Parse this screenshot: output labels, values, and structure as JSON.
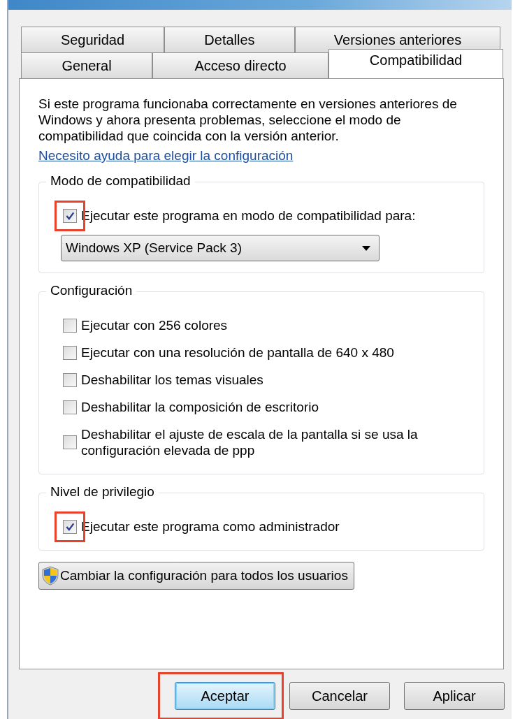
{
  "tabs": [
    [
      {
        "label": "Seguridad",
        "selected": false
      },
      {
        "label": "Detalles",
        "selected": false
      },
      {
        "label": "Versiones anteriores",
        "selected": false
      }
    ],
    [
      {
        "label": "General",
        "selected": false
      },
      {
        "label": "Acceso directo",
        "selected": false
      },
      {
        "label": "Compatibilidad",
        "selected": true
      }
    ]
  ],
  "description": "Si este programa funcionaba correctamente en versiones anteriores de Windows y ahora presenta problemas, seleccione el modo de compatibilidad que coincida con la versión anterior.",
  "help_link": "Necesito ayuda para elegir la configuración",
  "groups": [
    {
      "title": "Modo de compatibilidad",
      "items": [
        {
          "kind": "checkbox",
          "label": "Ejecutar este programa en modo de compatibilidad para:",
          "checked": true,
          "highlighted": true
        },
        {
          "kind": "dropdown",
          "value": "Windows XP (Service Pack 3)"
        }
      ]
    },
    {
      "title": "Configuración",
      "items": [
        {
          "kind": "checkbox",
          "label": "Ejecutar con 256 colores",
          "checked": false,
          "highlighted": false
        },
        {
          "kind": "checkbox",
          "label": "Ejecutar con una resolución de pantalla de 640 x 480",
          "checked": false,
          "highlighted": false
        },
        {
          "kind": "checkbox",
          "label": "Deshabilitar los temas visuales",
          "checked": false,
          "highlighted": false
        },
        {
          "kind": "checkbox",
          "label": "Deshabilitar la composición de escritorio",
          "checked": false,
          "highlighted": false
        },
        {
          "kind": "checkbox",
          "label": "Deshabilitar el ajuste de escala de la pantalla si se usa la configuración elevada de ppp",
          "checked": false,
          "highlighted": false
        }
      ]
    },
    {
      "title": "Nivel de privilegio",
      "items": [
        {
          "kind": "checkbox",
          "label": "Ejecutar este programa como administrador",
          "checked": true,
          "highlighted": true
        }
      ]
    }
  ],
  "shield_button": "Cambiar la configuración para todos los usuarios",
  "buttons": [
    {
      "label": "Aceptar",
      "default": true,
      "highlighted": true
    },
    {
      "label": "Cancelar",
      "default": false,
      "highlighted": false
    },
    {
      "label": "Aplicar",
      "default": false,
      "highlighted": false
    }
  ]
}
